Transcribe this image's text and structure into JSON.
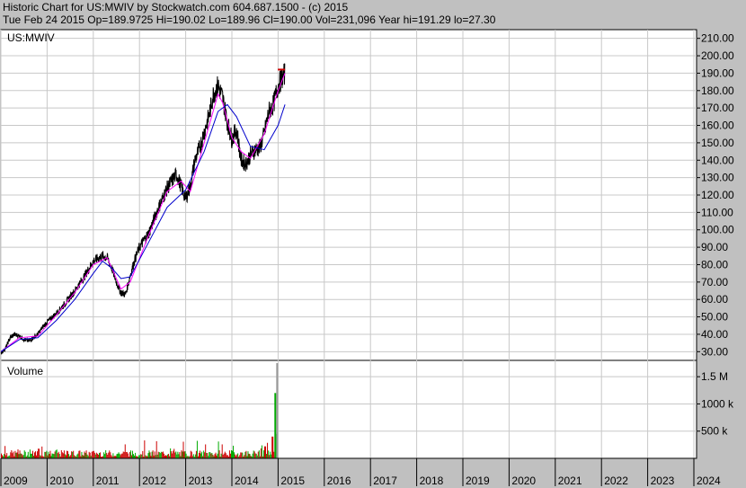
{
  "header": {
    "line1": "Historic Chart for US:MWIV by Stockwatch.com 604.687.1500 - (c) 2015",
    "line2": "Tue Feb 24 2015   Op=189.9725   Hi=190.02   Lo=189.96   Cl=190.00   Vol=231,096   Year hi=191.29   lo=27.30"
  },
  "colors": {
    "price": "#000000",
    "ma_short": "#ff00ff",
    "ma_long": "#0000cc",
    "vol_up": "#00aa00",
    "vol_down": "#cc0000",
    "grid": "#c8c8c8",
    "background": "#ffffff"
  },
  "chart_data": [
    {
      "type": "line",
      "title": "US:MWIV",
      "ylim": [
        25,
        215
      ],
      "xlim": [
        2009,
        2025
      ],
      "yticks": [
        "210.00",
        "200.00",
        "190.00",
        "180.00",
        "170.00",
        "160.00",
        "150.00",
        "140.00",
        "130.00",
        "120.00",
        "110.00",
        "100.00",
        "90.00",
        "80.00",
        "70.00",
        "60.00",
        "50.00",
        "40.00",
        "30.00"
      ],
      "grid": true,
      "series": [
        {
          "style": "price",
          "x": [
            2009.0,
            2009.1,
            2009.2,
            2009.3,
            2009.4,
            2009.5,
            2009.6,
            2009.7,
            2009.8,
            2009.9,
            2010.0,
            2010.2,
            2010.4,
            2010.6,
            2010.8,
            2011.0,
            2011.2,
            2011.3,
            2011.4,
            2011.5,
            2011.6,
            2011.7,
            2011.8,
            2011.9,
            2012.0,
            2012.2,
            2012.4,
            2012.6,
            2012.8,
            2013.0,
            2013.1,
            2013.2,
            2013.3,
            2013.4,
            2013.5,
            2013.6,
            2013.7,
            2013.8,
            2013.9,
            2014.0,
            2014.1,
            2014.2,
            2014.3,
            2014.4,
            2014.5,
            2014.6,
            2014.7,
            2014.8,
            2014.9,
            2015.0,
            2015.15
          ],
          "y": [
            29,
            32,
            38,
            40,
            39,
            37,
            36,
            38,
            40,
            44,
            47,
            52,
            58,
            65,
            73,
            82,
            85,
            84,
            78,
            70,
            64,
            63,
            74,
            83,
            90,
            98,
            112,
            124,
            132,
            118,
            125,
            140,
            147,
            156,
            165,
            178,
            183,
            176,
            162,
            152,
            158,
            140,
            138,
            143,
            146,
            147,
            155,
            168,
            172,
            183,
            190
          ]
        },
        {
          "style": "ma_short",
          "x": [
            2009.0,
            2009.4,
            2009.8,
            2010.2,
            2010.6,
            2011.0,
            2011.3,
            2011.6,
            2011.8,
            2012.2,
            2012.6,
            2012.9,
            2013.1,
            2013.4,
            2013.7,
            2013.8,
            2014.0,
            2014.2,
            2014.4,
            2014.7,
            2015.0,
            2015.15
          ],
          "y": [
            30,
            38,
            39,
            51,
            64,
            80,
            84,
            66,
            70,
            97,
            122,
            128,
            122,
            150,
            178,
            173,
            153,
            145,
            141,
            155,
            180,
            190
          ]
        },
        {
          "style": "ma_long",
          "x": [
            2009.0,
            2009.4,
            2009.8,
            2010.2,
            2010.6,
            2011.0,
            2011.2,
            2011.4,
            2011.6,
            2011.8,
            2012.2,
            2012.6,
            2013.0,
            2013.4,
            2013.7,
            2013.9,
            2014.1,
            2014.4,
            2014.7,
            2015.0,
            2015.15
          ],
          "y": [
            30,
            37,
            38,
            48,
            60,
            75,
            82,
            78,
            72,
            73,
            93,
            113,
            123,
            145,
            168,
            172,
            165,
            148,
            146,
            160,
            172
          ]
        }
      ]
    },
    {
      "type": "bar",
      "title": "Volume",
      "ylim": [
        0,
        1800000
      ],
      "yticks": [
        "1.5 M",
        "1000 k",
        "500 k"
      ],
      "markers": [
        {
          "x": 2014.92,
          "value": 1200000,
          "color": "vol_up"
        },
        {
          "x": 2014.95,
          "value": 450000,
          "color": "vol_up"
        },
        {
          "x": 2014.96,
          "value": 1750000,
          "color": "gray"
        },
        {
          "x": 2014.86,
          "value": 400000,
          "color": "vol_down"
        },
        {
          "x": 2014.7,
          "value": 220000,
          "color": "vol_down"
        }
      ]
    }
  ],
  "xaxis": {
    "years": [
      "2009",
      "2010",
      "2011",
      "2012",
      "2013",
      "2014",
      "2015",
      "2016",
      "2017",
      "2018",
      "2019",
      "2020",
      "2021",
      "2022",
      "2023",
      "2024"
    ]
  }
}
